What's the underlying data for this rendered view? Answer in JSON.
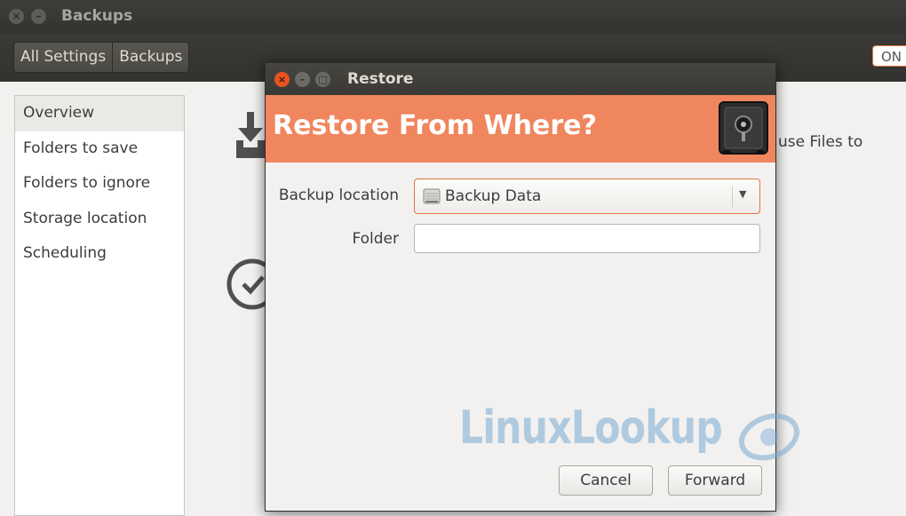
{
  "window": {
    "title": "Backups"
  },
  "toolbar": {
    "crumbs": [
      "All Settings",
      "Backups"
    ],
    "switch_label": "ON"
  },
  "sidebar": {
    "items": [
      {
        "label": "Overview",
        "selected": true
      },
      {
        "label": "Folders to save",
        "selected": false
      },
      {
        "label": "Folders to ignore",
        "selected": false
      },
      {
        "label": "Storage location",
        "selected": false
      },
      {
        "label": "Scheduling",
        "selected": false
      }
    ]
  },
  "main": {
    "partial_text": "use Files to",
    "icons": [
      "download-tray-icon",
      "clock-icon"
    ]
  },
  "dialog": {
    "title": "Restore",
    "banner_title": "Restore From Where?",
    "banner_icon": "safe-icon",
    "backup_location_label": "Backup location",
    "backup_location_value": "Backup Data",
    "backup_location_icon": "drive-icon",
    "folder_label": "Folder",
    "folder_value": "",
    "cancel_label": "Cancel",
    "forward_label": "Forward"
  },
  "watermark": {
    "text": "LinuxLookup"
  },
  "colors": {
    "accent": "#e95420",
    "banner": "#f0865e",
    "titlebar": "#3c3b37",
    "background": "#f2f1f0"
  }
}
